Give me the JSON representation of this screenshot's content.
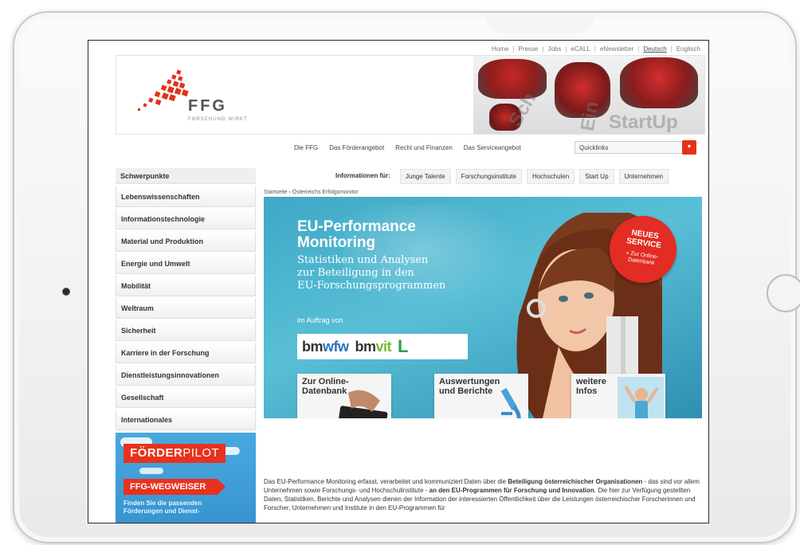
{
  "top_links": [
    {
      "label": "Home"
    },
    {
      "label": "Presse"
    },
    {
      "label": "Jobs"
    },
    {
      "label": "eCALL"
    },
    {
      "label": "eNewsletter"
    },
    {
      "label": "Deutsch",
      "active": true
    },
    {
      "label": "Englisch"
    }
  ],
  "brand": {
    "name": "FFG",
    "tagline": "FORSCHUNG WIRKT",
    "accent": "#e3321a"
  },
  "header_photo_words": [
    "Sch",
    "Ein",
    "StartUp"
  ],
  "main_nav": [
    "Die FFG",
    "Das Förderangebot",
    "Recht und Finanzen",
    "Das Serviceangebot"
  ],
  "quicklinks": {
    "label": "Quicklinks",
    "icon": "chevron-down-icon"
  },
  "secondary_bar": {
    "left_title": "Schwerpunkte",
    "info_label": "Informationen für:",
    "tabs": [
      "Junge Talente",
      "Forschungsinstitute",
      "Hochschulen",
      "Start Up",
      "Unternehmen"
    ]
  },
  "sidebar": [
    "Lebenswissenschaften",
    "Informationstechnologie",
    "Material und Produktion",
    "Energie und Umwelt",
    "Mobilität",
    "Weltraum",
    "Sicherheit",
    "Karriere in der Forschung",
    "Dienstleistungsinnovationen",
    "Gesellschaft",
    "Internationales"
  ],
  "promo": {
    "foerderpilot_a": "FÖRDER",
    "foerderpilot_b": "PILOT",
    "wegweiser": "FFG-WEGWEISER",
    "text_1": "Finden Sie die passenden",
    "text_2": "Förderungen und Dienst-"
  },
  "breadcrumb": "Startseite › Österreichs Erfolgsmonitor",
  "hero": {
    "title_1": "EU-Performance",
    "title_2": "Monitoring",
    "sub_1": "Statistiken und Analysen",
    "sub_2": "zur Beteiligung in den",
    "sub_3": "EU-Forschungsprogrammen",
    "auftrag": "im Auftrag von",
    "logo_1a": "bm",
    "logo_1b": "wfw",
    "logo_2a": "bm",
    "logo_2b": "vit",
    "logo_3": "L",
    "badge_1": "NEUES",
    "badge_2": "SERVICE",
    "badge_3": "» Zur Online-",
    "badge_4": "Datenbank"
  },
  "tiles": [
    {
      "title_1": "Zur Online-",
      "title_2": "Datenbank"
    },
    {
      "title_1": "Auswertungen",
      "title_2": "und Berichte"
    },
    {
      "title_1": "weitere",
      "title_2": "Infos"
    }
  ],
  "body": {
    "p1_a": "Das EU-Performance Monitoring erfasst, verarbeitet und kommuniziert Daten über die ",
    "p1_b": "Beteiligung österreichischer Organisationen",
    "p1_c": " - das sind vor allem Unternehmen sowie Forschungs- und Hochschulinstitute - ",
    "p1_d": "an den EU-Programmen für Forschung und Innovation",
    "p1_e": ". Die hier zur Verfügung gestellten Daten, Statistiken, Berichte und Analysen dienen der Information der interessierten Öffentlichkeit über die Leistungen österreichischer Forscherinnen und Forscher, Unternehmen und Institute in den EU-Programmen für"
  }
}
